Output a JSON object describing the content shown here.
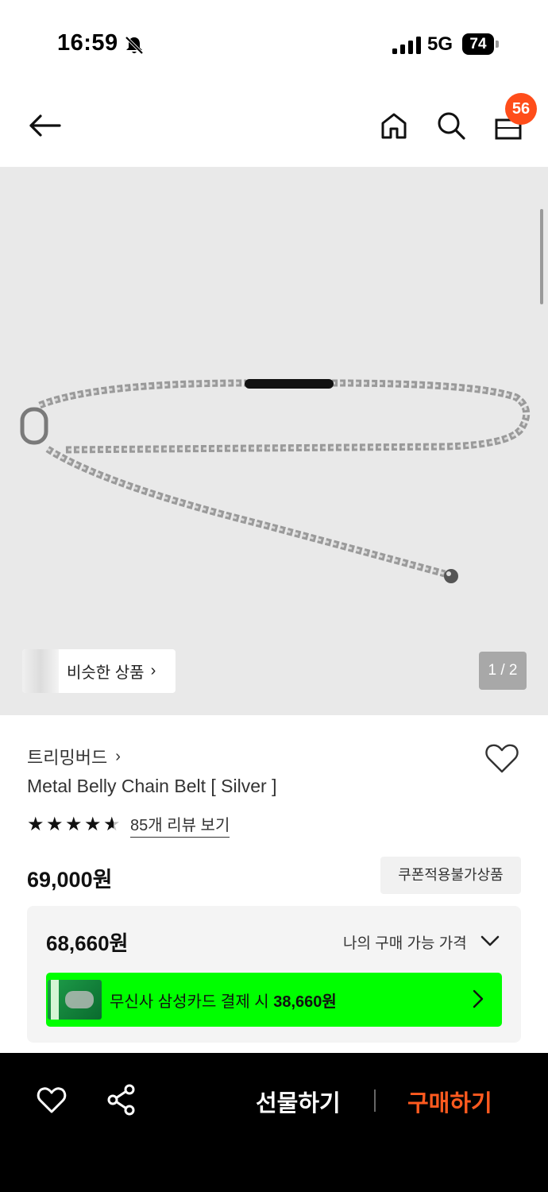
{
  "status_bar": {
    "time": "16:59",
    "network": "5G",
    "battery": "74",
    "icons": [
      "bell-slash-icon",
      "signal-icon",
      "battery-icon"
    ]
  },
  "nav": {
    "cart_count": "56",
    "icons": [
      "back-arrow-icon",
      "home-icon",
      "search-icon",
      "shopping-bag-icon"
    ]
  },
  "gallery": {
    "similar_label": "비슷한 상품",
    "page_indicator": "1 / 2",
    "background_color": "#e9e9e9"
  },
  "product": {
    "brand": "트리밍버드",
    "name": "Metal Belly Chain Belt [ Silver ]",
    "rating": 4.5,
    "review_link": "85개 리뷰 보기",
    "price": "69,000원",
    "coupon_badge": "쿠폰적용불가상품",
    "best_price": "68,660원",
    "my_price_label": "나의 구매 가능 가격",
    "promo_text_prefix": "무신사 삼성카드 결제 시 ",
    "promo_price": "38,660원",
    "promo_color": "#00ff00"
  },
  "bottom_bar": {
    "gift_label": "선물하기",
    "buy_label": "구매하기",
    "accent_color": "#ff5a1f",
    "icons": [
      "heart-icon",
      "share-icon"
    ]
  }
}
